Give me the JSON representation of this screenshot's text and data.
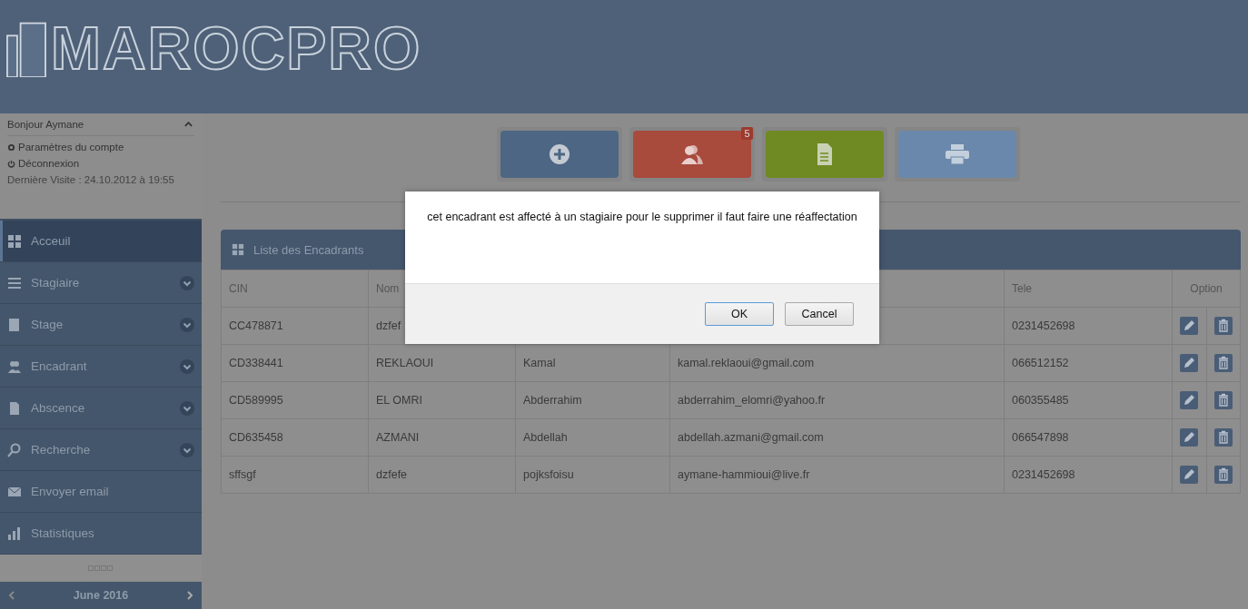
{
  "header": {
    "logo": "MAROCPRO"
  },
  "user_panel": {
    "greeting": "Bonjour Aymane",
    "expanded": true,
    "links": [
      {
        "kind": "settings",
        "label": "Paramètres du compte"
      },
      {
        "kind": "logout",
        "label": "Déconnexion"
      }
    ],
    "last_visit": "Dernière Visite : 24.10.2012 à 19:55"
  },
  "sidebar": {
    "items": [
      {
        "kind": "grid",
        "label": "Acceuil",
        "selected": true,
        "expandable": false
      },
      {
        "kind": "list",
        "label": "Stagiaire",
        "selected": false,
        "expandable": true
      },
      {
        "kind": "book",
        "label": "Stage",
        "selected": false,
        "expandable": true
      },
      {
        "kind": "users",
        "label": "Encadrant",
        "selected": false,
        "expandable": true
      },
      {
        "kind": "doc",
        "label": "Abscence",
        "selected": false,
        "expandable": true
      },
      {
        "kind": "search",
        "label": "Recherche",
        "selected": false,
        "expandable": true
      },
      {
        "kind": "mail",
        "label": "Envoyer email",
        "selected": false,
        "expandable": false
      },
      {
        "kind": "chart",
        "label": "Statistiques",
        "selected": false,
        "expandable": false
      }
    ]
  },
  "calendar": {
    "month": "June 2016"
  },
  "toolbar": [
    {
      "kind": "add",
      "color": "#4d6684"
    },
    {
      "kind": "users",
      "color": "#a84a3c",
      "badge": "5"
    },
    {
      "kind": "doc",
      "color": "#6f8a22"
    },
    {
      "kind": "print",
      "color": "#6a88ab"
    }
  ],
  "table": {
    "title": "Liste des Encadrants",
    "columns": [
      {
        "label": "CIN"
      },
      {
        "label": "Nom"
      },
      {},
      {},
      {
        "label": "Tele"
      },
      {
        "label": "Option"
      }
    ],
    "rows": [
      {
        "cin": "CC478871",
        "nom": "dzfef",
        "tele": "0231452698"
      },
      {
        "cin": "CD338441",
        "nom": "REKLAOUI",
        "prenom": "Kamal",
        "email": "kamal.reklaoui@gmail.com",
        "tele": "066512152"
      },
      {
        "cin": "CD589995",
        "nom": "EL OMRI",
        "prenom": "Abderrahim",
        "email": "abderrahim_elomri@yahoo.fr",
        "tele": "060355485"
      },
      {
        "cin": "CD635458",
        "nom": "AZMANI",
        "prenom": "Abdellah",
        "email": "abdellah.azmani@gmail.com",
        "tele": "066547898"
      },
      {
        "cin": "sffsgf",
        "nom": "dzfefe",
        "prenom": "pojksfoisu",
        "email": "aymane-hammioui@live.fr",
        "tele": "0231452698"
      }
    ]
  },
  "dialog": {
    "message": "cet encadrant est affecté à un stagiaire pour le supprimer il faut faire une réaffectation",
    "buttons": [
      {
        "label": "OK",
        "selected": true
      },
      {
        "label": "Cancel",
        "selected": false
      }
    ]
  }
}
